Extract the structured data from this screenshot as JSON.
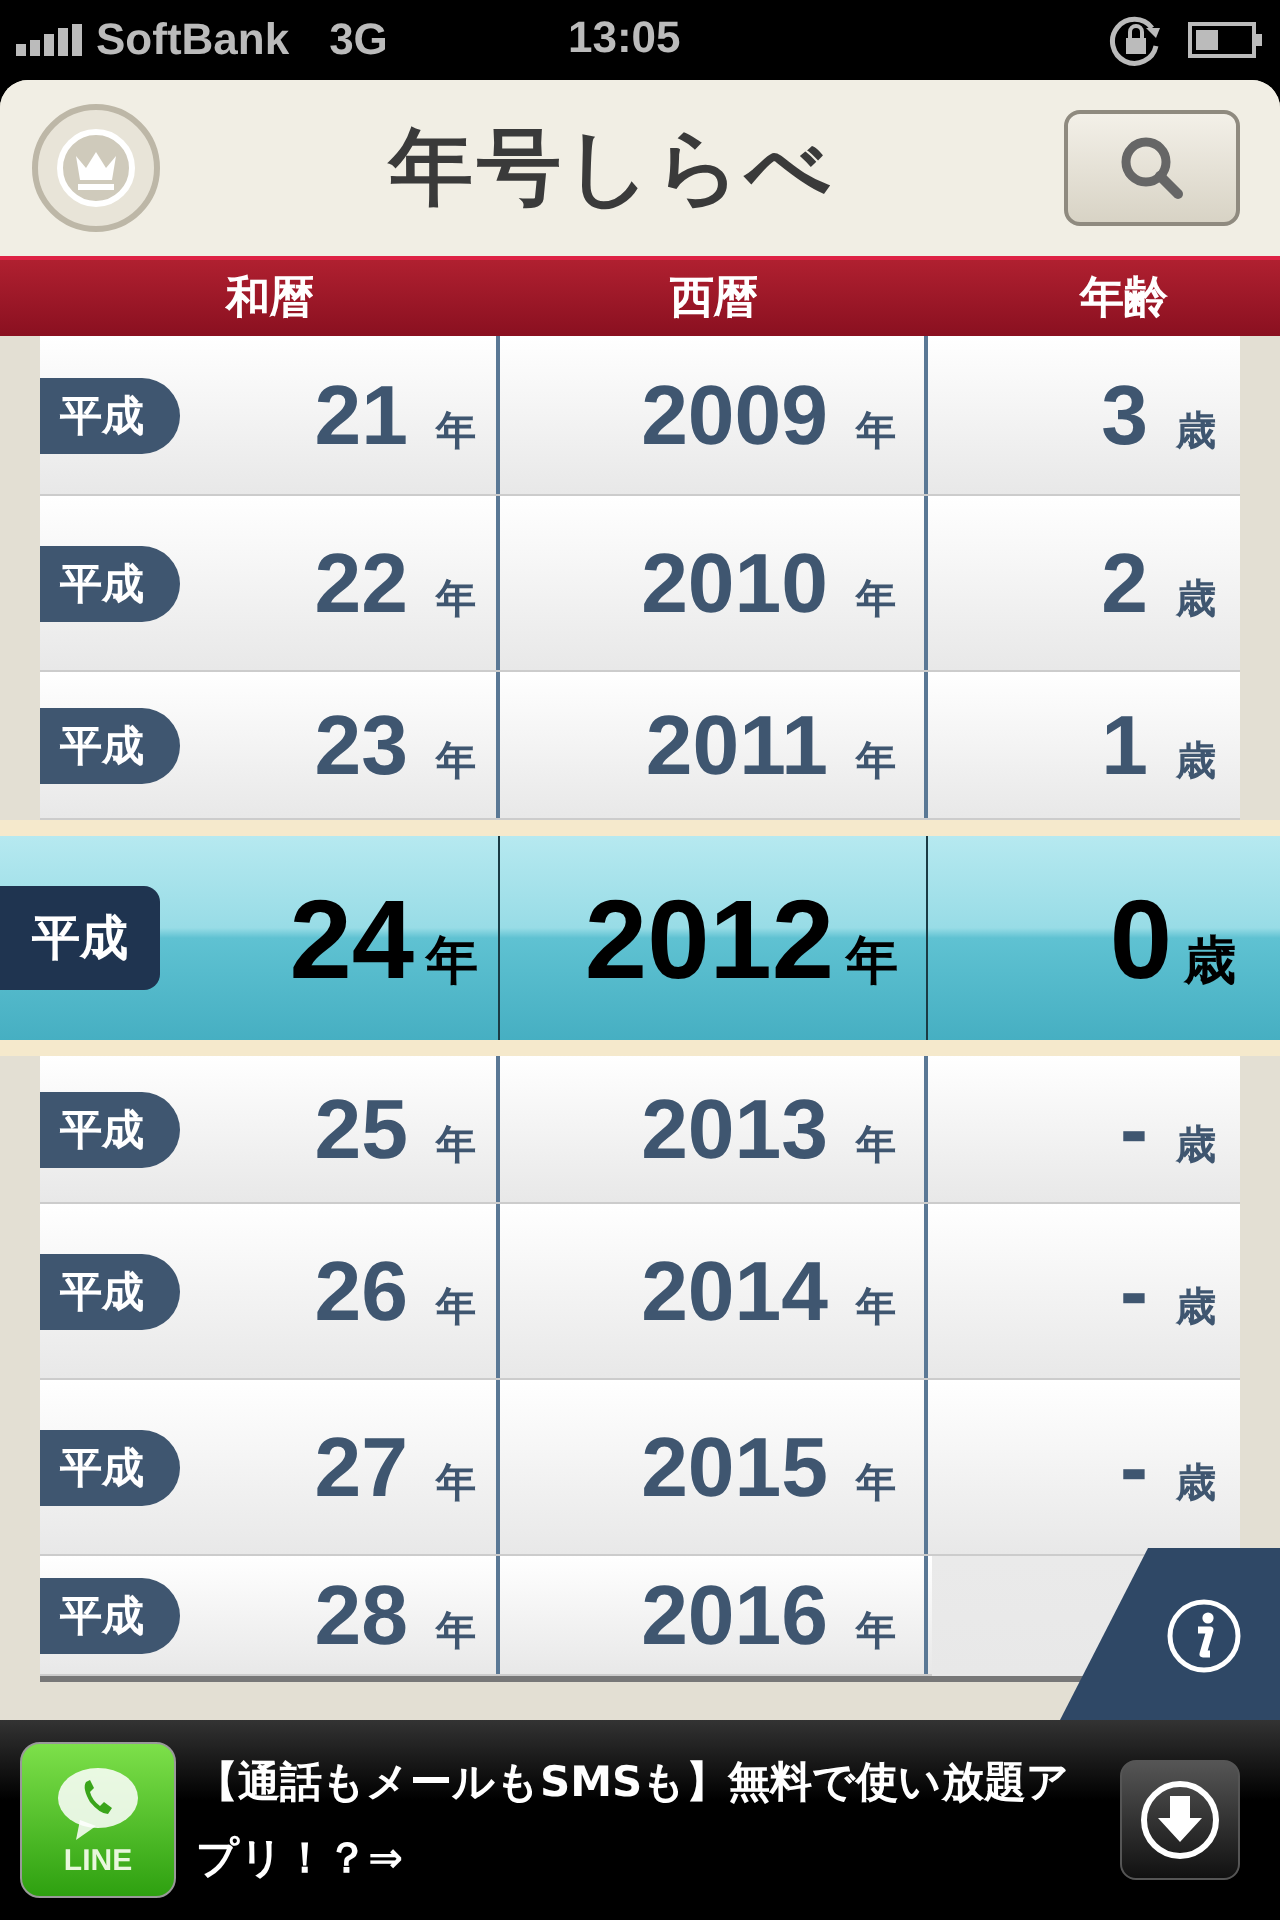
{
  "status_bar": {
    "carrier": "SoftBank",
    "network": "3G",
    "time": "13:05"
  },
  "header": {
    "title": "年号しらべ"
  },
  "columns": [
    "和暦",
    "西暦",
    "年齢"
  ],
  "rows": [
    {
      "era": "平成",
      "year": "21",
      "year_unit": "年",
      "western": "2009",
      "western_unit": "年",
      "age": "3",
      "age_unit": "歳",
      "selected": false
    },
    {
      "era": "平成",
      "year": "22",
      "year_unit": "年",
      "western": "2010",
      "western_unit": "年",
      "age": "2",
      "age_unit": "歳",
      "selected": false
    },
    {
      "era": "平成",
      "year": "23",
      "year_unit": "年",
      "western": "2011",
      "western_unit": "年",
      "age": "1",
      "age_unit": "歳",
      "selected": false
    },
    {
      "era": "平成",
      "year": "24",
      "year_unit": "年",
      "western": "2012",
      "western_unit": "年",
      "age": "0",
      "age_unit": "歳",
      "selected": true
    },
    {
      "era": "平成",
      "year": "25",
      "year_unit": "年",
      "western": "2013",
      "western_unit": "年",
      "age": "-",
      "age_unit": "歳",
      "selected": false
    },
    {
      "era": "平成",
      "year": "26",
      "year_unit": "年",
      "western": "2014",
      "western_unit": "年",
      "age": "-",
      "age_unit": "歳",
      "selected": false
    },
    {
      "era": "平成",
      "year": "27",
      "year_unit": "年",
      "western": "2015",
      "western_unit": "年",
      "age": "-",
      "age_unit": "歳",
      "selected": false
    },
    {
      "era": "平成",
      "year": "28",
      "year_unit": "年",
      "western": "2016",
      "western_unit": "年",
      "selected": false
    }
  ],
  "ad": {
    "app_label": "LINE",
    "text": "【通話もメールもSMSも】無料で使い放題アプリ！？⇒"
  }
}
